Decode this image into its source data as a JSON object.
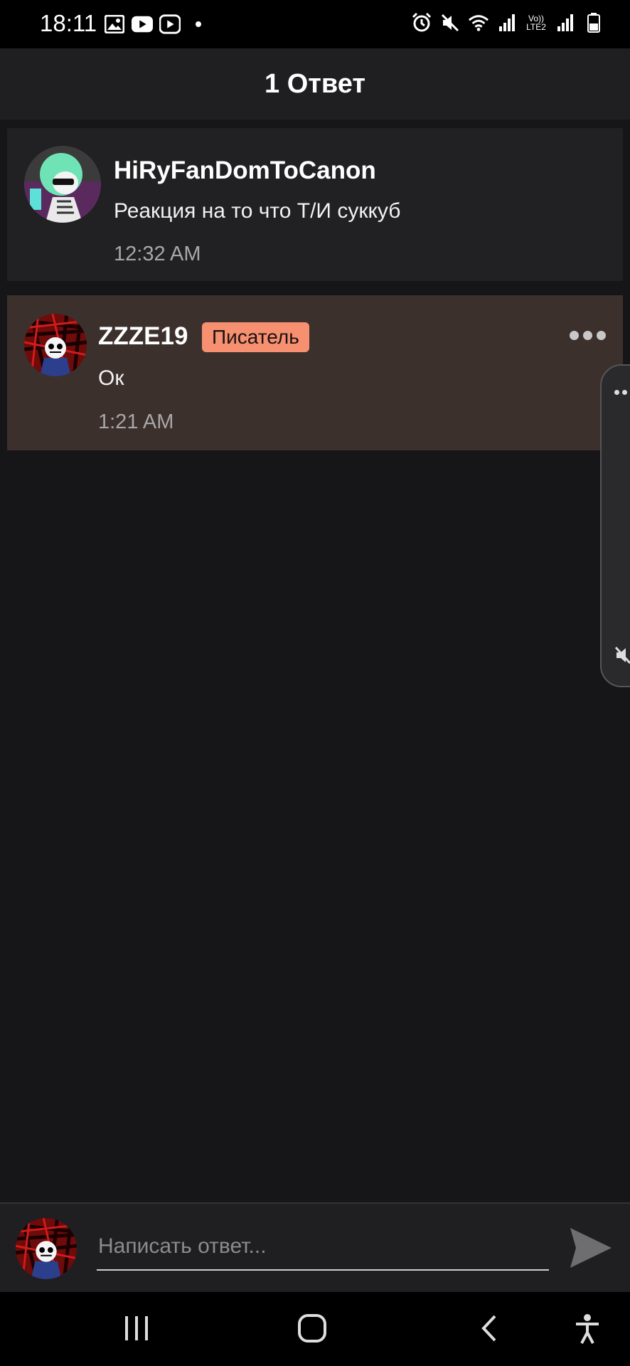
{
  "status_bar": {
    "time": "18:11",
    "network_label": "Vo)) LTE2"
  },
  "header": {
    "title": "1 Ответ"
  },
  "comments": [
    {
      "username": "HiRyFanDomToCanon",
      "text": "Реакция на то что Т/И суккуб",
      "time": "12:32 AM"
    },
    {
      "username": "ZZZE19",
      "badge": "Писатель",
      "text": "Ок",
      "time": "1:21 AM"
    }
  ],
  "composer": {
    "placeholder": "Написать ответ..."
  },
  "colors": {
    "background": "#161517",
    "header": "#1f1e20",
    "highlight_comment": "#3c302d",
    "badge": "#f69070"
  }
}
